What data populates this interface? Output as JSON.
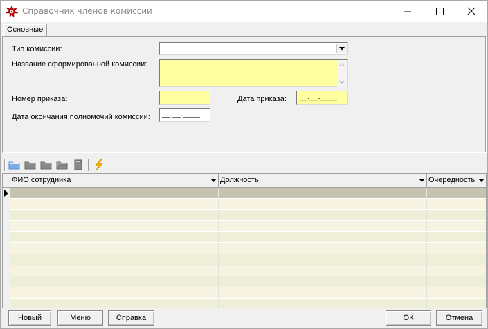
{
  "window": {
    "title": "Справочник членов комиссии",
    "icon": "app-star-icon",
    "controls": [
      "minimize-icon",
      "maximize-icon",
      "close-icon"
    ]
  },
  "tabs": [
    {
      "label": "Основные",
      "active": true
    }
  ],
  "form": {
    "commission_type": {
      "label": "Тип комиссии:",
      "value": ""
    },
    "formed_name": {
      "label": "Название сформированной комиссии:",
      "value": ""
    },
    "order_number": {
      "label": "Номер приказа:",
      "value": ""
    },
    "order_date": {
      "label": "Дата приказа:",
      "value": "__.__.____"
    },
    "powers_end_date": {
      "label": "Дата окончания полномочий комиссии:",
      "value": "__.__.____"
    }
  },
  "toolbar": {
    "icons": [
      "folder-open-icon",
      "folder-new-icon",
      "folder-edit-icon",
      "folder-delete-icon",
      "document-icon",
      "lightning-icon"
    ]
  },
  "grid": {
    "columns": [
      "ФИО сотрудника",
      "Должность",
      "Очередность"
    ],
    "rows": [
      [
        "",
        "",
        ""
      ],
      [
        "",
        "",
        ""
      ],
      [
        "",
        "",
        ""
      ],
      [
        "",
        "",
        ""
      ],
      [
        "",
        "",
        ""
      ],
      [
        "",
        "",
        ""
      ],
      [
        "",
        "",
        ""
      ],
      [
        "",
        "",
        ""
      ],
      [
        "",
        "",
        ""
      ],
      [
        "",
        "",
        ""
      ],
      [
        "",
        "",
        ""
      ]
    ]
  },
  "buttons": {
    "new": {
      "label": "Новый"
    },
    "menu": {
      "label": "Меню"
    },
    "help": {
      "label": "Справка"
    },
    "ok": {
      "label": "ОК"
    },
    "cancel": {
      "label": "Отмена"
    }
  },
  "colors": {
    "required_field": "#ffffa0",
    "grid_row_odd": "#f7f3e3",
    "grid_row_even": "#efefd9",
    "grid_row_selected": "#c6c4b0",
    "icon_star": "#c40000",
    "icon_folder": "#5a8fd0",
    "icon_lightning": "#f0b400"
  }
}
